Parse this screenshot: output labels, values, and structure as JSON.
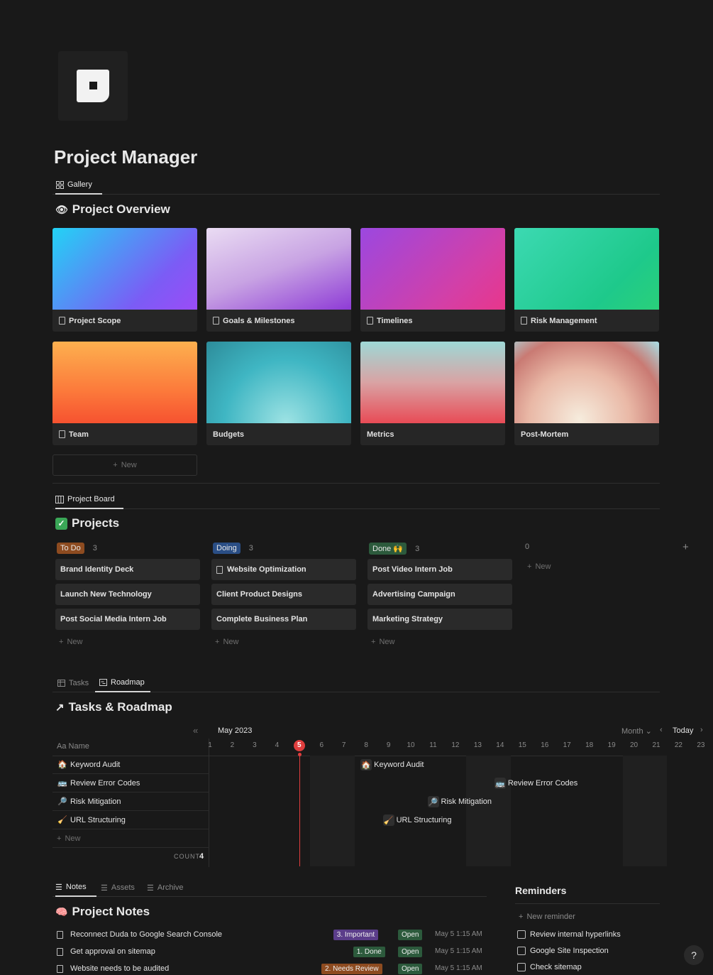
{
  "page": {
    "title": "Project Manager"
  },
  "gallery": {
    "tab_label": "Gallery",
    "title": "Project Overview",
    "new_label": "New",
    "cards": [
      {
        "label": "Project Scope",
        "has_page_icon": true,
        "cover": "linear-gradient(135deg,#22d3f5,#7b5cf5 70%,#9b4cf7)"
      },
      {
        "label": "Goals & Milestones",
        "has_page_icon": true,
        "cover": "linear-gradient(160deg,#eadcf3,#c8a3e3 50%,#8e3bd6)"
      },
      {
        "label": "Timelines",
        "has_page_icon": true,
        "cover": "linear-gradient(135deg,#9b48e0,#d43fa6 70%,#e8368b)"
      },
      {
        "label": "Risk Management",
        "has_page_icon": true,
        "cover": "linear-gradient(135deg,#3cd9b2,#1ec98b 70%,#2ad07a)"
      },
      {
        "label": "Team",
        "has_page_icon": true,
        "cover": "linear-gradient(180deg,#fdb04f,#fc7a3b 60%,#f65230)"
      },
      {
        "label": "Budgets",
        "has_page_icon": false,
        "cover": "radial-gradient(ellipse at 55% 100%,#9ee3e4,#3fb6c3 55%,#2d8c9a)"
      },
      {
        "label": "Metrics",
        "has_page_icon": false,
        "cover": "linear-gradient(180deg,#9ed8d6,#d9a3a4 50%,#e84b56)"
      },
      {
        "label": "Post-Mortem",
        "has_page_icon": false,
        "cover": "radial-gradient(ellipse at 45% 95%,#f6ecdd,#e9b8a6 45%,#c97a73 75%,#a8dfe6)"
      }
    ]
  },
  "board": {
    "tab_label": "Project Board",
    "title": "Projects",
    "new_label": "New",
    "columns": [
      {
        "name": "To Do",
        "count": "3",
        "color": "#8d4b20",
        "items": [
          "Brand Identity Deck",
          "Launch New Technology",
          "Post Social Media Intern Job"
        ],
        "icons": [
          false,
          false,
          false
        ]
      },
      {
        "name": "Doing",
        "count": "3",
        "color": "#2a4e85",
        "items": [
          "Website Optimization",
          "Client Product Designs",
          "Complete Business Plan"
        ],
        "icons": [
          true,
          false,
          false
        ]
      },
      {
        "name": "Done 🙌",
        "count": "3",
        "color": "#2c5a3c",
        "items": [
          "Post Video Intern Job",
          "Advertising Campaign",
          "Marketing Strategy"
        ],
        "icons": [
          false,
          false,
          false
        ]
      },
      {
        "name": "",
        "count": "0",
        "color": "",
        "items": [],
        "icons": []
      }
    ]
  },
  "roadmap": {
    "tabs": [
      "Tasks",
      "Roadmap"
    ],
    "title": "Tasks & Roadmap",
    "month": "May 2023",
    "view_label": "Month",
    "today_label": "Today",
    "name_header": "Aa Name",
    "new_label": "New",
    "count_label": "COUNT",
    "count_value": "4",
    "today_day": "5",
    "days": [
      "1",
      "2",
      "3",
      "4",
      "5",
      "6",
      "7",
      "8",
      "9",
      "10",
      "11",
      "12",
      "13",
      "14",
      "15",
      "16",
      "17",
      "18",
      "19",
      "20",
      "21",
      "22",
      "23"
    ],
    "tasks": [
      {
        "name": "Keyword Audit",
        "emoji": "🏠",
        "bar_day": 8
      },
      {
        "name": "Review Error Codes",
        "emoji": "🚌",
        "bar_day": 14
      },
      {
        "name": "Risk Mitigation",
        "emoji": "🔎",
        "bar_day": 11
      },
      {
        "name": "URL Structuring",
        "emoji": "🧹",
        "bar_day": 9
      }
    ]
  },
  "notes": {
    "tabs": [
      "Notes",
      "Assets",
      "Archive"
    ],
    "title": "Project Notes",
    "rows": [
      {
        "title": "Reconnect Duda to Google Search Console",
        "priority": "3. Important",
        "priority_color": "#5b3d8a",
        "status": "Open",
        "date": "May 5 1:15 AM"
      },
      {
        "title": "Get approval on sitemap",
        "priority": "1. Done",
        "priority_color": "#2c5a3c",
        "status": "Open",
        "date": "May 5 1:15 AM"
      },
      {
        "title": "Website needs to be audited",
        "priority": "2. Needs Review",
        "priority_color": "#8d4b20",
        "status": "Open",
        "date": "May 5 1:15 AM"
      }
    ]
  },
  "reminders": {
    "title": "Reminders",
    "new_label": "New reminder",
    "items": [
      "Review internal hyperlinks",
      "Google Site Inspection",
      "Check sitemap"
    ]
  },
  "help_label": "?"
}
